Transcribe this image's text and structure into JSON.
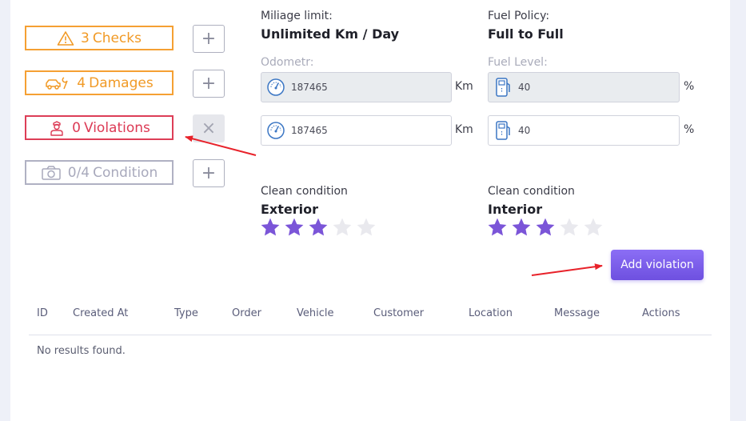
{
  "badges": {
    "checks": {
      "count": "3",
      "label": "Checks",
      "icon": "warning-icon"
    },
    "damages": {
      "count": "4",
      "label": "Damages",
      "icon": "car-wrench-icon"
    },
    "violations": {
      "count": "0",
      "label": "Violations",
      "icon": "officer-icon"
    },
    "condition": {
      "count": "0/4",
      "label": "Condition",
      "icon": "camera-icon"
    }
  },
  "side_buttons": {
    "plus": "+",
    "close": "×"
  },
  "mileage": {
    "label": "Miliage limit:",
    "value": "Unlimited Km / Day"
  },
  "fuel_policy": {
    "label": "Fuel Policy:",
    "value": "Full to Full"
  },
  "odometer": {
    "label": "Odometr:",
    "value_before": "187465",
    "value_after": "187465",
    "unit": "Km"
  },
  "fuel_level": {
    "label": "Fuel Level:",
    "value_before": "40",
    "value_after": "40",
    "unit": "%"
  },
  "clean_exterior": {
    "label": "Clean condition",
    "title": "Exterior",
    "rating": 3,
    "max": 5
  },
  "clean_interior": {
    "label": "Clean condition",
    "title": "Interior",
    "rating": 3,
    "max": 5
  },
  "add_violation_button": "Add violation",
  "table": {
    "columns": [
      "ID",
      "Created At",
      "Type",
      "Order",
      "Vehicle",
      "Customer",
      "Location",
      "Message",
      "Actions"
    ],
    "empty_text": "No results found."
  },
  "colors": {
    "star_on": "#7b55d8",
    "star_off": "#e9e9ee",
    "annotation_arrow": "#e8222a"
  }
}
